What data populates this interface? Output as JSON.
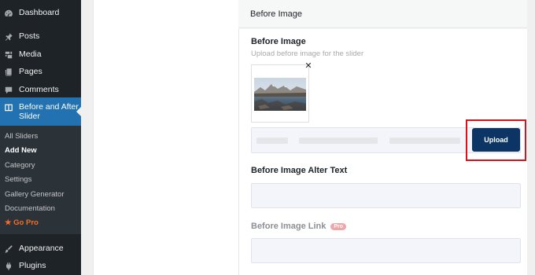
{
  "sidebar": {
    "items": [
      {
        "label": "Dashboard",
        "icon": "dashboard-icon"
      },
      {
        "label": "Posts",
        "icon": "pin-icon"
      },
      {
        "label": "Media",
        "icon": "media-icon"
      },
      {
        "label": "Pages",
        "icon": "pages-icon"
      },
      {
        "label": "Comments",
        "icon": "comment-icon"
      },
      {
        "label": "Before and After Slider",
        "icon": "slider-icon"
      },
      {
        "label": "Appearance",
        "icon": "paintbrush-icon"
      },
      {
        "label": "Plugins",
        "icon": "plugin-icon"
      }
    ],
    "submenu": [
      {
        "label": "All Sliders"
      },
      {
        "label": "Add New"
      },
      {
        "label": "Category"
      },
      {
        "label": "Settings"
      },
      {
        "label": "Gallery Generator"
      },
      {
        "label": "Documentation"
      },
      {
        "label": "★ Go Pro"
      }
    ]
  },
  "panel": {
    "header_title": "Before Image",
    "before_image": {
      "label": "Before Image",
      "description": "Upload before image for the slider",
      "remove_symbol": "✕",
      "upload_label": "Upload"
    },
    "alt_text": {
      "label": "Before Image Alter Text",
      "value": ""
    },
    "link": {
      "label": "Before Image Link",
      "badge": "Pro",
      "value": ""
    }
  },
  "colors": {
    "sidebar_bg": "#1d2327",
    "active_bg": "#2271b1",
    "upload_button": "#0c3464",
    "highlight": "#d1151d",
    "go_pro": "#f56e28"
  }
}
